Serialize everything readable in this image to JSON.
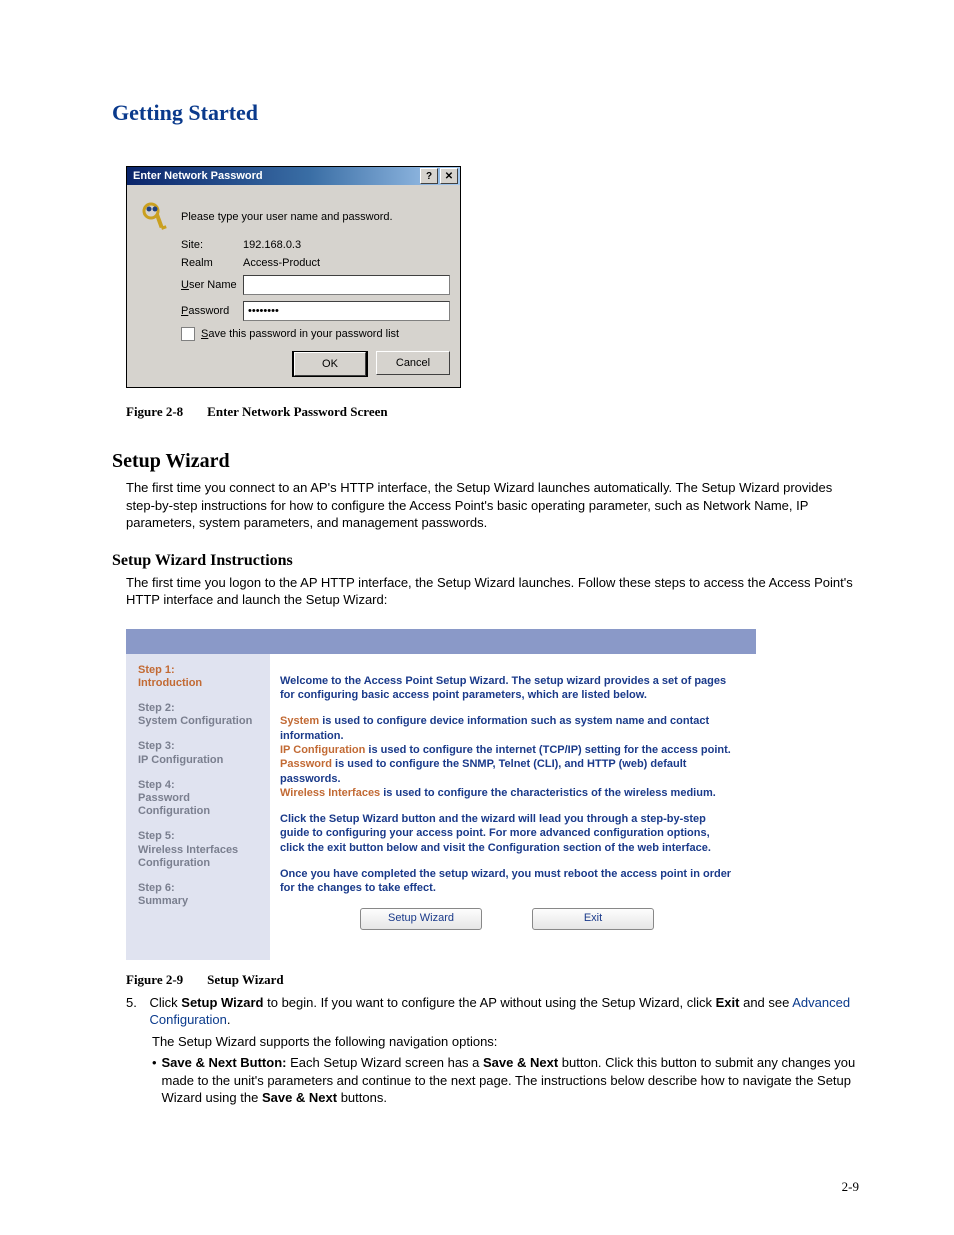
{
  "header": "Getting Started",
  "dialog": {
    "title": "Enter Network Password",
    "help": "?",
    "close": "✕",
    "prompt": "Please type your user name and password.",
    "site_label": "Site:",
    "site_value": "192.168.0.3",
    "realm_label": "Realm",
    "realm_value": "Access-Product",
    "user_label": "User Name",
    "user_value": "",
    "pass_label": "Password",
    "pass_value": "••••••••",
    "save_label": "Save this password in your password list",
    "ok": "OK",
    "cancel": "Cancel"
  },
  "fig8_num": "Figure 2-8",
  "fig8_title": "Enter Network Password Screen",
  "h2_setup": "Setup Wizard",
  "p_setup": "The first time you connect to an AP's HTTP interface, the Setup Wizard launches automatically. The Setup Wizard provides step-by-step instructions for how to configure the Access Point's basic operating parameter, such as Network Name, IP parameters, system parameters, and management passwords.",
  "h3_instr": "Setup Wizard Instructions",
  "p_instr": "The first time you logon to the AP HTTP interface, the Setup Wizard launches. Follow these steps to access the Access Point's HTTP interface and launch the Setup Wizard:",
  "wiz": {
    "steps": [
      {
        "n": "Step 1:",
        "t": "Introduction",
        "active": true
      },
      {
        "n": "Step 2:",
        "t": "System Configuration"
      },
      {
        "n": "Step 3:",
        "t": "IP Configuration"
      },
      {
        "n": "Step 4:",
        "t": "Password Configuration"
      },
      {
        "n": "Step 5:",
        "t": "Wireless Interfaces Configuration"
      },
      {
        "n": "Step 6:",
        "t": "Summary"
      }
    ],
    "p1": "Welcome to the Access Point Setup Wizard. The setup wizard provides a set of pages for configuring basic access point parameters, which are listed below.",
    "l1a": "System",
    "l1b": " is used to configure device information such as system name and contact information.",
    "l2a": "IP Configuration",
    "l2b": " is used to configure the internet (TCP/IP) setting for the access point.",
    "l3a": "Password",
    "l3b": " is used to configure the SNMP, Telnet (CLI), and HTTP (web) default passwords.",
    "l4a": "Wireless Interfaces",
    "l4b": " is used to configure the characteristics of the wireless medium.",
    "p3": "Click the Setup Wizard button and the wizard will lead you through a step-by-step guide to configuring your access point. For more advanced configuration options, click the exit button below and visit the Configuration section of the web interface.",
    "p4": "Once you have completed the setup wizard, you must reboot the access point in order for the changes to take effect.",
    "btn_setup": "Setup Wizard",
    "btn_exit": "Exit"
  },
  "fig9_num": "Figure 2-9",
  "fig9_title": "Setup Wizard",
  "item5_num": "5.",
  "item5_a": "Click ",
  "item5_b": "Setup Wizard",
  "item5_c": " to begin. If you want to configure the AP without using the Setup Wizard, click ",
  "item5_d": "Exit",
  "item5_e": " and see ",
  "item5_link": "Advanced Configuration",
  "item5_f": ".",
  "p_nav": "The Setup Wizard supports the following navigation options:",
  "bullet_dot": "•",
  "b1a": "Save & Next Button: ",
  "b1b": "Each Setup Wizard screen has a ",
  "b1c": "Save & Next",
  "b1d": " button. Click this button to submit any changes you made to the unit's parameters and continue to the next page. The instructions below describe how to navigate the Setup Wizard using the ",
  "b1e": "Save & Next",
  "b1f": " buttons.",
  "page_number": "2-9"
}
